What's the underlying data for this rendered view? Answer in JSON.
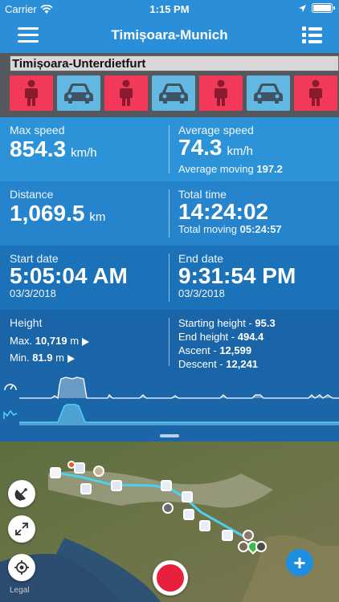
{
  "status_bar": {
    "carrier": "Carrier",
    "time": "1:15 PM"
  },
  "nav": {
    "title": "Timișoara-Munich"
  },
  "segments": {
    "title": "Timișoara-Unterdietfurt",
    "items": [
      "walk",
      "car",
      "walk",
      "car",
      "walk",
      "car",
      "walk"
    ],
    "colors": {
      "walk": "#f2395a",
      "car": "#62b8e0"
    }
  },
  "stats": {
    "max_speed": {
      "label": "Max speed",
      "value": "854.3",
      "unit": "km/h"
    },
    "avg_speed": {
      "label": "Average speed",
      "value": "74.3",
      "unit": "km/h",
      "sub_label": "Average moving",
      "sub_value": "197.2"
    },
    "distance": {
      "label": "Distance",
      "value": "1,069.5",
      "unit": "km"
    },
    "total_time": {
      "label": "Total time",
      "value": "14:24:02",
      "sub_label": "Total moving",
      "sub_value": "05:24:57"
    },
    "start_date": {
      "label": "Start date",
      "value": "5:05:04 AM",
      "date": "03/3/2018"
    },
    "end_date": {
      "label": "End date",
      "value": "9:31:54 PM",
      "date": "03/3/2018"
    },
    "height": {
      "label": "Height",
      "max_label": "Max.",
      "max_value": "10,719",
      "max_unit": "m",
      "min_label": "Min.",
      "min_value": "81.9",
      "min_unit": "m"
    },
    "elevation": {
      "starting_label": "Starting height -",
      "starting_value": "95.3",
      "end_label": "End height -",
      "end_value": "494.4",
      "ascent_label": "Ascent -",
      "ascent_value": "12,599",
      "descent_label": "Descent -",
      "descent_value": "12,241"
    }
  },
  "map": {
    "legal": "Legal"
  }
}
